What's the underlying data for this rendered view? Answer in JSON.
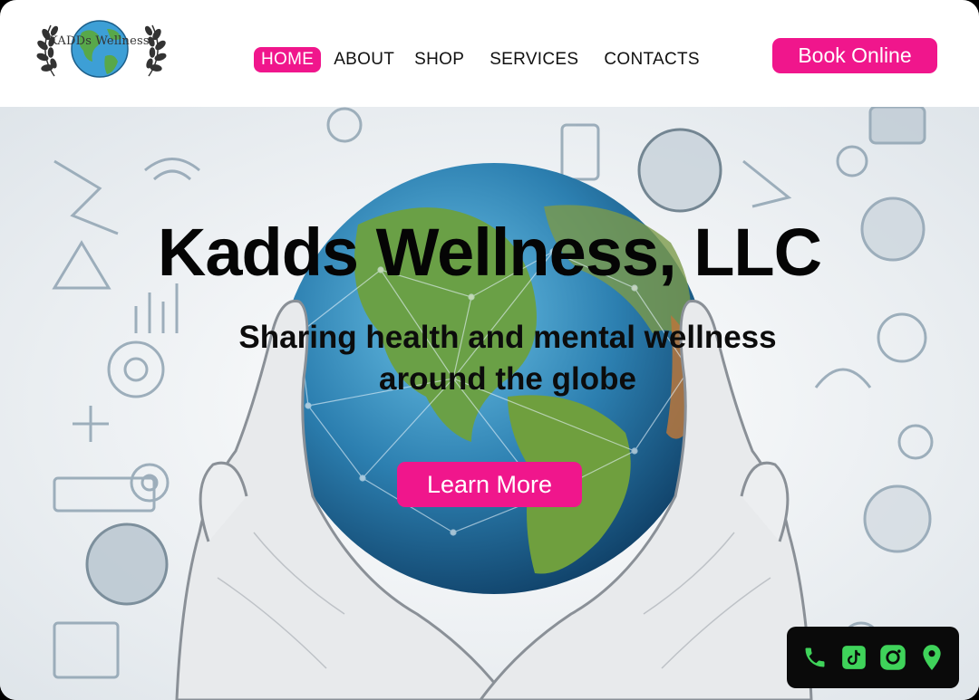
{
  "header": {
    "logo_text": "KADDs Wellness",
    "nav": [
      {
        "label": "HOME",
        "active": true
      },
      {
        "label": "ABOUT",
        "active": false
      },
      {
        "label": "SHOP",
        "active": false
      },
      {
        "label": "SERVICES",
        "active": false
      },
      {
        "label": "CONTACTS",
        "active": false
      }
    ],
    "book_label": "Book Online"
  },
  "hero": {
    "title": "Kadds Wellness, LLC",
    "subtitle": "Sharing health and mental wellness around the globe",
    "cta_label": "Learn More"
  },
  "social": {
    "icons": [
      "phone-icon",
      "tiktok-icon",
      "instagram-icon",
      "location-pin-icon"
    ]
  },
  "colors": {
    "accent": "#f0168c",
    "social_icon": "#3fd35a",
    "social_bar": "#0a0a0a"
  }
}
